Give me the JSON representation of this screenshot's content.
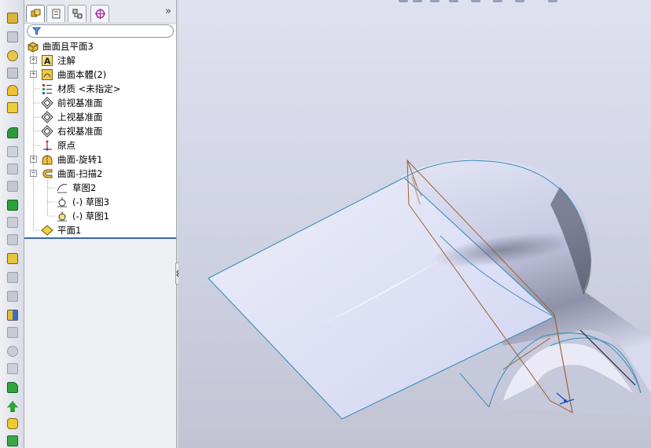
{
  "feature_tree": {
    "root": {
      "label": "曲面且平面3",
      "icon": "part-icon"
    },
    "items": [
      {
        "label": "注解",
        "icon": "annotations-icon",
        "expandable": true,
        "indent": 1
      },
      {
        "label": "曲面本體(2)",
        "icon": "surface-bodies-icon",
        "expandable": true,
        "indent": 1
      },
      {
        "label": "材质 <未指定>",
        "icon": "material-icon",
        "expandable": false,
        "indent": 1
      },
      {
        "label": "前视基准面",
        "icon": "plane-icon",
        "expandable": false,
        "indent": 1
      },
      {
        "label": "上视基准面",
        "icon": "plane-icon",
        "expandable": false,
        "indent": 1
      },
      {
        "label": "右视基准面",
        "icon": "plane-icon",
        "expandable": false,
        "indent": 1
      },
      {
        "label": "原点",
        "icon": "origin-icon",
        "expandable": false,
        "indent": 1
      },
      {
        "label": "曲面-旋转1",
        "icon": "surface-revolve-icon",
        "expandable": true,
        "indent": 1
      },
      {
        "label": "曲面-扫描2",
        "icon": "surface-sweep-icon",
        "expandable": true,
        "expanded": true,
        "indent": 1
      },
      {
        "label": "草图2",
        "icon": "sketch-icon",
        "expandable": false,
        "indent": 2
      },
      {
        "label": "(-) 草图3",
        "icon": "sketch-icon",
        "expandable": false,
        "indent": 2
      },
      {
        "label": "(-) 草图1",
        "icon": "sketch-icon",
        "expandable": false,
        "indent": 2
      },
      {
        "label": "平面1",
        "icon": "planar-surface-icon",
        "expandable": false,
        "indent": 1
      }
    ]
  },
  "panel_tabs": [
    "feature-manager-icon",
    "property-manager-icon",
    "configuration-manager-icon",
    "dimxpert-icon"
  ],
  "expand_chevron": "»",
  "colors": {
    "accent": "#3a66b5",
    "surface_edge": "#3b8fb8",
    "sketch_line": "#a06030",
    "surface_fill": "#dde0f6"
  }
}
